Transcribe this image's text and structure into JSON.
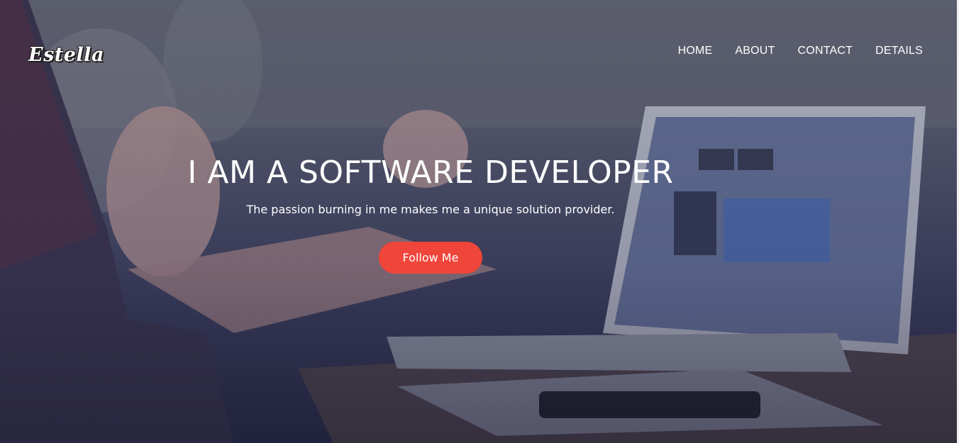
{
  "brand": {
    "logo_text": "Estella"
  },
  "nav": {
    "items": [
      {
        "label": "HOME"
      },
      {
        "label": "ABOUT"
      },
      {
        "label": "CONTACT"
      },
      {
        "label": "DETAILS"
      }
    ]
  },
  "hero": {
    "title": "I AM A SOFTWARE DEVELOPER",
    "subtitle": "The passion burning in me makes me a unique solution provider.",
    "cta_label": "Follow Me"
  },
  "colors": {
    "accent": "#f0453a",
    "overlay": "#3e4160"
  }
}
